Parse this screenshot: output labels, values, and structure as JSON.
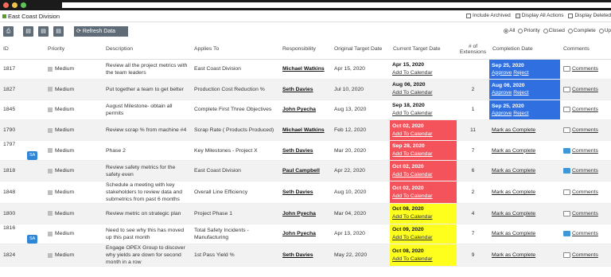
{
  "header": {
    "title": "East Coast Division",
    "options": [
      "Include Archived",
      "Display All Actions",
      "Display Deleted"
    ],
    "options_checked": [
      false,
      true,
      false
    ]
  },
  "toolbar": {
    "refresh_label": "Refresh Data",
    "filters": [
      "All",
      "Priority",
      "Closed",
      "Complete",
      "Up"
    ],
    "filter_selected": "All"
  },
  "columns": [
    "ID",
    "Priority",
    "Description",
    "Applies To",
    "Responsibility",
    "Original Target Date",
    "Current Target Date",
    "# of Extensions",
    "Completion Date",
    "Comments"
  ],
  "rows": [
    {
      "id": "1817",
      "priority": "Medium",
      "description": "Review all the project metrics with the team leaders",
      "applies_to": "East Coast Division",
      "responsibility": "Michael Watkins",
      "original": "Apr 15, 2020",
      "current": "Apr 15, 2020",
      "calendar": "Add To Calendar",
      "extensions": "",
      "completion_date": "Sep 25, 2020",
      "approve": "Approve",
      "reject": "Reject",
      "comments": "Comments"
    },
    {
      "id": "1827",
      "priority": "Medium",
      "description": "Put together a team to get better",
      "applies_to": "Production Cost Reduction %",
      "responsibility": "Seth Davies",
      "original": "Jul 10, 2020",
      "current": "Aug 06, 2020",
      "calendar": "Add To Calendar",
      "extensions": "2",
      "completion_date": "Aug 06, 2020",
      "approve": "Approve",
      "reject": "Reject",
      "comments": "Comments"
    },
    {
      "id": "1845",
      "priority": "Medium",
      "description": "August Milestone- obtain all permits",
      "applies_to": "Complete First Three Objectives",
      "responsibility": "John Pyecha",
      "original": "Aug 13, 2020",
      "current": "Sep 18, 2020",
      "calendar": "Add To Calendar",
      "extensions": "1",
      "completion_date": "Sep 25, 2020",
      "approve": "Approve",
      "reject": "Reject",
      "comments": "Comments"
    },
    {
      "id": "1790",
      "priority": "Medium",
      "description": "Review scrap % from machine #4",
      "applies_to": "Scrap Rate ( Products Produced)",
      "responsibility": "Michael Watkins",
      "original": "Feb 12, 2020",
      "current": "Oct 02, 2020",
      "calendar": "Add To Calendar",
      "extensions": "11",
      "mark": "Mark as Complete",
      "comments": "Comments"
    },
    {
      "id": "1797",
      "badge": "SA",
      "priority": "Medium",
      "description": "Phase 2",
      "applies_to": "Key Milestones - Project X",
      "responsibility": "Seth Davies",
      "original": "Mar 20, 2020",
      "current": "Sep 28, 2020",
      "calendar": "Add To Calendar",
      "extensions": "7",
      "mark": "Mark as Complete",
      "comments": "Comments"
    },
    {
      "id": "1818",
      "priority": "Medium",
      "description": "Review safety metrics for the safety even",
      "applies_to": "East Coast Division",
      "responsibility": "Paul Campbell",
      "original": "Apr 22, 2020",
      "current": "Oct 02, 2020",
      "calendar": "Add To Calendar",
      "extensions": "6",
      "mark": "Mark as Complete",
      "comments": "Comments"
    },
    {
      "id": "1848",
      "priority": "Medium",
      "description": "Schedule a meeting with key stakeholders to review data and submetrics from past 6 months",
      "applies_to": "Overall Line Efficiency",
      "responsibility": "Seth Davies",
      "original": "Aug 10, 2020",
      "current": "Oct 02, 2020",
      "calendar": "Add To Calendar",
      "extensions": "2",
      "mark": "Mark as Complete",
      "comments": "Comments"
    },
    {
      "id": "1800",
      "priority": "Medium",
      "description": "Review metric on strategic plan",
      "applies_to": "Project Phase 1",
      "responsibility": "John Pyecha",
      "original": "Mar 04, 2020",
      "current": "Oct 08, 2020",
      "calendar": "Add To Calendar",
      "extensions": "4",
      "mark": "Mark as Complete",
      "comments": "Comments"
    },
    {
      "id": "1816",
      "badge": "SA",
      "priority": "Medium",
      "description": "Need to see why this has moved up this past month",
      "applies_to": "Total Safety Incidents - Manufacturing",
      "responsibility": "John Pyecha",
      "original": "Apr 13, 2020",
      "current": "Oct 09, 2020",
      "calendar": "Add To Calendar",
      "extensions": "7",
      "mark": "Mark as Complete",
      "comments": "Comments"
    },
    {
      "id": "1824",
      "priority": "Medium",
      "description": "Engage OPEX Group to discover why yields are down for second month in a row",
      "applies_to": "1st Pass Yield %",
      "responsibility": "Seth Davies",
      "original": "May 22, 2020",
      "current": "Oct 08, 2020",
      "calendar": "Add To Calendar",
      "extensions": "9",
      "mark": "Mark as Complete",
      "comments": "Comments"
    }
  ],
  "colors": {
    "red": "#f5535b",
    "yellow": "#ffff1e",
    "blue": "#2f6fe0",
    "toolbar": "#5f6c78"
  }
}
